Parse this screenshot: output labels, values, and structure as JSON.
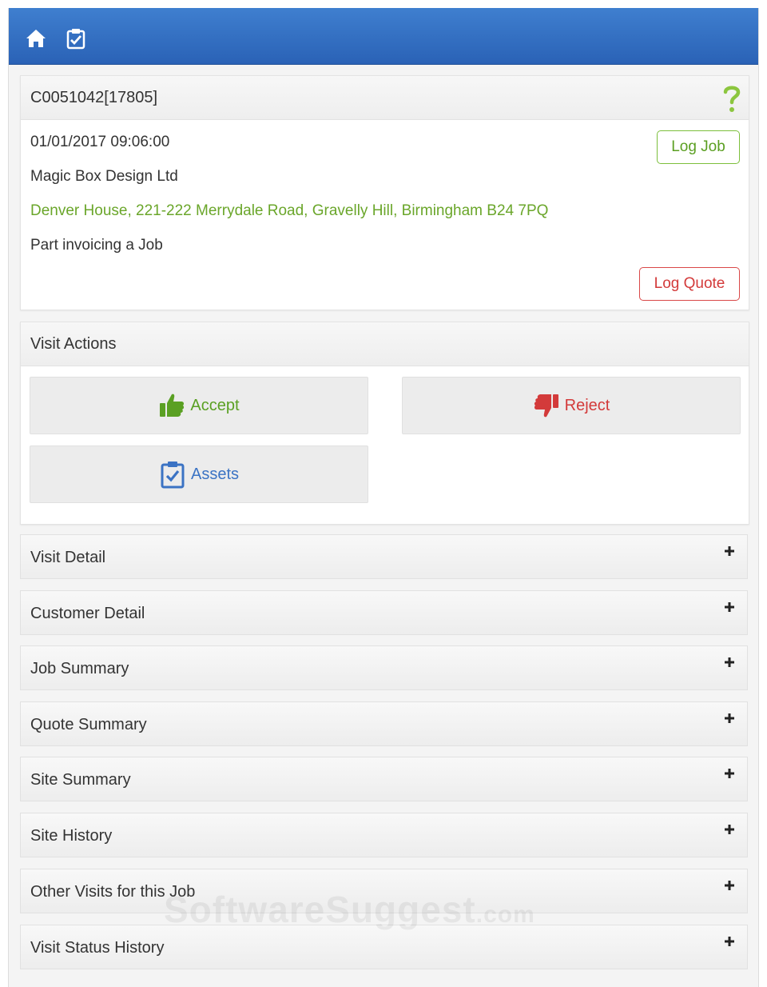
{
  "header": {
    "icons": [
      "home-icon",
      "clipboard-check-icon"
    ],
    "background": "#2f6cc0"
  },
  "job": {
    "id": "C0051042[17805]",
    "datetime": "01/01/2017 09:06:00",
    "company": "Magic Box Design Ltd",
    "address": "Denver House, 221-222 Merrydale Road, Gravelly Hill, Birmingham B24 7PQ",
    "description": "Part invoicing a Job",
    "log_job_label": "Log Job",
    "log_quote_label": "Log Quote"
  },
  "visit_actions": {
    "title": "Visit Actions",
    "accept_label": "Accept",
    "reject_label": "Reject",
    "assets_label": "Assets"
  },
  "sections": [
    "Visit Detail",
    "Customer Detail",
    "Job Summary",
    "Quote Summary",
    "Site Summary",
    "Site History",
    "Other Visits for this Job",
    "Visit Status History"
  ],
  "watermark": {
    "main": "SoftwareSuggest",
    "suffix": ".com"
  },
  "colors": {
    "accent_green": "#6aa62a",
    "reject_red": "#d33a3a",
    "assets_blue": "#3b73c4"
  }
}
